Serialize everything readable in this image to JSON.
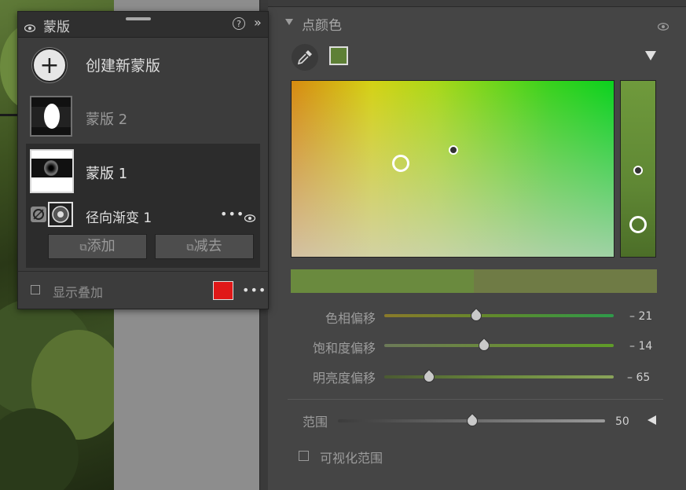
{
  "mask_panel": {
    "title": "蒙版",
    "help_symbol": "?",
    "expand_symbol": "»",
    "create_symbol": "+",
    "create_label": "创建新蒙版",
    "masks": [
      {
        "label": "蒙版 2"
      },
      {
        "label": "蒙版 1"
      }
    ],
    "tool_label": "径向渐变 1",
    "more_dots": "•••",
    "add_label": "添加",
    "subtract_label": "减去",
    "overlay_label": "显示叠加",
    "overlay_color": "#e01818"
  },
  "point_color": {
    "section_title": "点颜色",
    "swatch_color": "#5e8036",
    "preview_colors": [
      "#6a8a3e",
      "#6f7b45"
    ],
    "sliders": [
      {
        "label": "色相偏移",
        "value": "– 21",
        "position": 0.4
      },
      {
        "label": "饱和度偏移",
        "value": "– 14",
        "position": 0.43
      },
      {
        "label": "明亮度偏移",
        "value": "– 65",
        "position": 0.19
      }
    ],
    "range": {
      "label": "范围",
      "value": "50",
      "position": 0.5
    },
    "visualize_label": "可视化范围"
  }
}
